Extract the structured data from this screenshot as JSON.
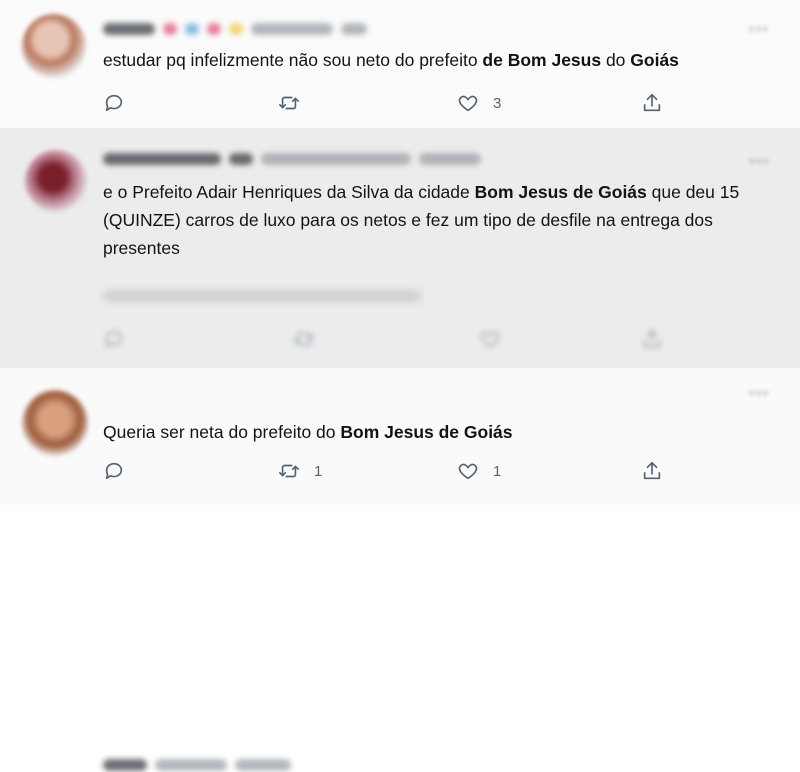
{
  "tweets": [
    {
      "segments": [
        {
          "text": "estudar pq infelizmente não sou neto do prefeito ",
          "bold": false
        },
        {
          "text": "de Bom Jesus",
          "bold": true
        },
        {
          "text": " do ",
          "bold": false
        },
        {
          "text": "Goiás",
          "bold": true
        }
      ],
      "retweets": "",
      "likes": "3"
    },
    {
      "segments": [
        {
          "text": "e o Prefeito Adair Henriques da Silva da cidade ",
          "bold": false
        },
        {
          "text": "Bom Jesus de Goiás",
          "bold": true
        },
        {
          "text": " que deu 15 (QUINZE) carros de luxo para os netos e fez um tipo de desfile na entrega dos presentes",
          "bold": false
        }
      ],
      "retweets": "",
      "likes": ""
    },
    {
      "segments": [
        {
          "text": "Queria ser neta do prefeito do ",
          "bold": false
        },
        {
          "text": "Bom Jesus de Goiás",
          "bold": true
        }
      ],
      "retweets": "1",
      "likes": "1"
    }
  ],
  "icons": {
    "reply": "reply-icon",
    "retweet": "retweet-icon",
    "like": "heart-icon",
    "share": "share-icon",
    "more": "more-options-icon"
  },
  "colors": {
    "text": "#0f1419",
    "secondary": "#536471"
  }
}
